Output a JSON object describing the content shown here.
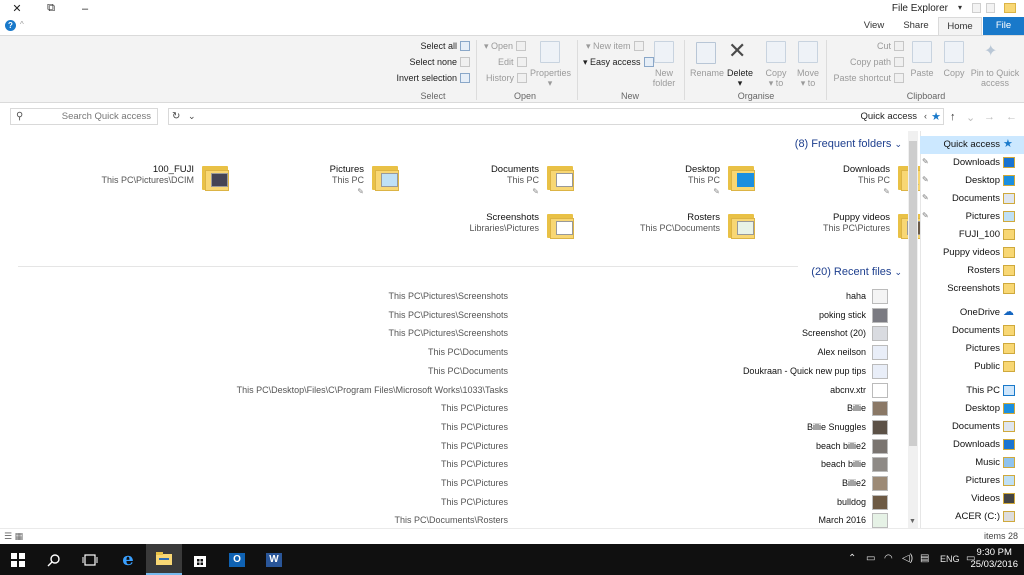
{
  "window": {
    "title": "File Explorer",
    "minimize_glyph": "–",
    "restore_glyph": "⧉",
    "close_glyph": "✕",
    "help_glyph": "?"
  },
  "ribbon_tabs": [
    {
      "label": "View"
    },
    {
      "label": "Share"
    },
    {
      "label": "Home"
    },
    {
      "label": "File"
    }
  ],
  "ribbon": {
    "select": {
      "label": "Select",
      "select_all": "Select all",
      "select_none": "Select none",
      "invert_selection": "Invert selection"
    },
    "open": {
      "label": "Open",
      "open": "Open",
      "edit": "Edit",
      "history": "History",
      "properties": "Properties"
    },
    "new": {
      "label": "New",
      "new_item": "New item",
      "easy_access": "Easy access",
      "new_folder_l1": "New",
      "new_folder_l2": "folder"
    },
    "organise": {
      "label": "Organise",
      "rename": "Rename",
      "delete": "Delete",
      "copy_to_l1": "Copy",
      "copy_to_l2": "to",
      "move_to_l1": "Move",
      "move_to_l2": "to"
    },
    "clipboard": {
      "label": "Clipboard",
      "cut": "Cut",
      "copy_path": "Copy path",
      "paste_shortcut": "Paste shortcut",
      "paste": "Paste",
      "copy": "Copy",
      "pin_l1": "Pin to Quick",
      "pin_l2": "access"
    }
  },
  "address": {
    "search_placeholder": "Search Quick access",
    "path": "Quick access"
  },
  "frequent_folders": {
    "heading": "(8) Frequent folders",
    "items": [
      {
        "name": "100_FUJI",
        "path": "This PC\\Pictures\\DCIM"
      },
      {
        "name": "Pictures",
        "path": "This PC"
      },
      {
        "name": "Documents",
        "path": "This PC"
      },
      {
        "name": "Desktop",
        "path": "This PC"
      },
      {
        "name": "Downloads",
        "path": "This PC"
      },
      {
        "name": "Screenshots",
        "path": "Libraries\\Pictures"
      },
      {
        "name": "Rosters",
        "path": "This PC\\Documents"
      },
      {
        "name": "Puppy videos",
        "path": "This PC\\Pictures"
      }
    ]
  },
  "recent_files": {
    "heading": "(20) Recent files",
    "items": [
      {
        "name": "haha",
        "location": "This PC\\Pictures\\Screenshots"
      },
      {
        "name": "poking stick",
        "location": "This PC\\Pictures\\Screenshots"
      },
      {
        "name": "Screenshot (20)",
        "location": "This PC\\Pictures\\Screenshots"
      },
      {
        "name": "Alex neilson",
        "location": "This PC\\Documents"
      },
      {
        "name": "Doukraan - Quick new pup tips",
        "location": "This PC\\Documents"
      },
      {
        "name": "abcnv.xtr",
        "location": "This PC\\Desktop\\Files\\C\\Program Files\\Microsoft Works\\1033\\Tasks"
      },
      {
        "name": "Billie",
        "location": "This PC\\Pictures"
      },
      {
        "name": "Billie Snuggles",
        "location": "This PC\\Pictures"
      },
      {
        "name": "beach billie2",
        "location": "This PC\\Pictures"
      },
      {
        "name": "beach billie",
        "location": "This PC\\Pictures"
      },
      {
        "name": "Billie2",
        "location": "This PC\\Pictures"
      },
      {
        "name": "bulldog",
        "location": "This PC\\Pictures"
      },
      {
        "name": "March 2016",
        "location": "This PC\\Documents\\Rosters"
      }
    ]
  },
  "nav_pane": {
    "quick_access": "Quick access",
    "quick_items": [
      "Downloads",
      "Desktop",
      "Documents",
      "Pictures",
      "FUJI_100",
      "Puppy videos",
      "Rosters",
      "Screenshots"
    ],
    "onedrive": "OneDrive",
    "onedrive_items": [
      "Documents",
      "Pictures",
      "Public"
    ],
    "this_pc": "This PC",
    "pc_items": [
      "Desktop",
      "Documents",
      "Downloads",
      "Music",
      "Pictures",
      "Videos",
      "ACER (C:)"
    ]
  },
  "status": {
    "count": "items 28"
  },
  "taskbar": {
    "time": "9:30 PM",
    "date": "25/03/2016",
    "lang": "ENG"
  },
  "colors": {
    "accent": "#1979ca",
    "folder": "#f8d774",
    "heading": "#1e3f8e"
  }
}
